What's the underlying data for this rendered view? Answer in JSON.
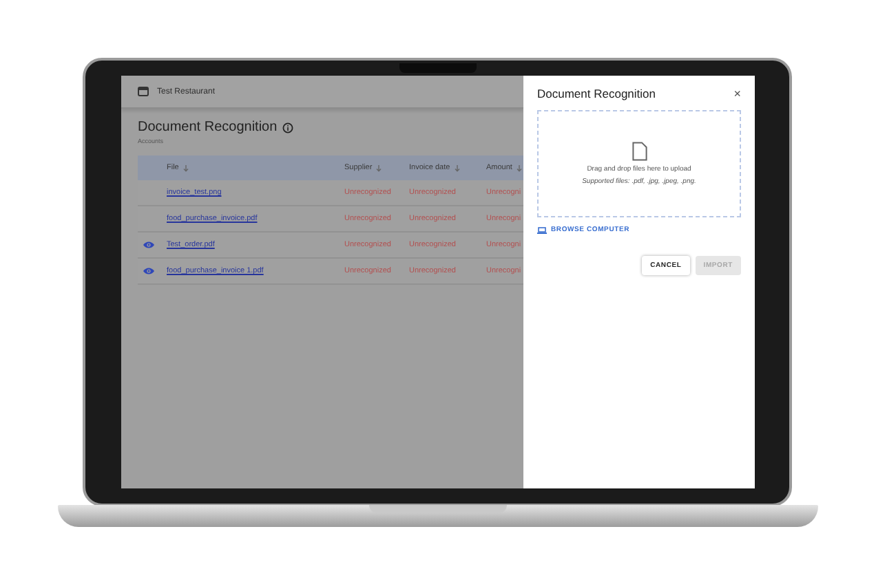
{
  "app": {
    "restaurant": "Test Restaurant",
    "title": "Document Recognition",
    "subtitle": "Accounts"
  },
  "table": {
    "columns": [
      {
        "label": "File"
      },
      {
        "label": "Supplier"
      },
      {
        "label": "Invoice date"
      },
      {
        "label": "Amount"
      }
    ],
    "rows": [
      {
        "preview": false,
        "file": "invoice_test.png",
        "supplier": "Unrecognized",
        "invoice_date": "Unrecognized",
        "amount": "Unrecogni"
      },
      {
        "preview": false,
        "file": "food_purchase_invoice.pdf",
        "supplier": "Unrecognized",
        "invoice_date": "Unrecognized",
        "amount": "Unrecogni"
      },
      {
        "preview": true,
        "file": "Test_order.pdf",
        "supplier": "Unrecognized",
        "invoice_date": "Unrecognized",
        "amount": "Unrecogni"
      },
      {
        "preview": true,
        "file": "food_purchase_invoice 1.pdf",
        "supplier": "Unrecognized",
        "invoice_date": "Unrecognized",
        "amount": "Unrecogni"
      }
    ]
  },
  "dialog": {
    "title": "Document Recognition",
    "close": "×",
    "dropzone": {
      "text": "Drag and drop files here to upload",
      "supported": "Supported files: .pdf, .jpg, .jpeg, .png."
    },
    "browse": "BROWSE COMPUTER",
    "buttons": [
      {
        "label": "CANCEL",
        "disabled": false
      },
      {
        "label": "IMPORT",
        "disabled": true
      }
    ]
  }
}
